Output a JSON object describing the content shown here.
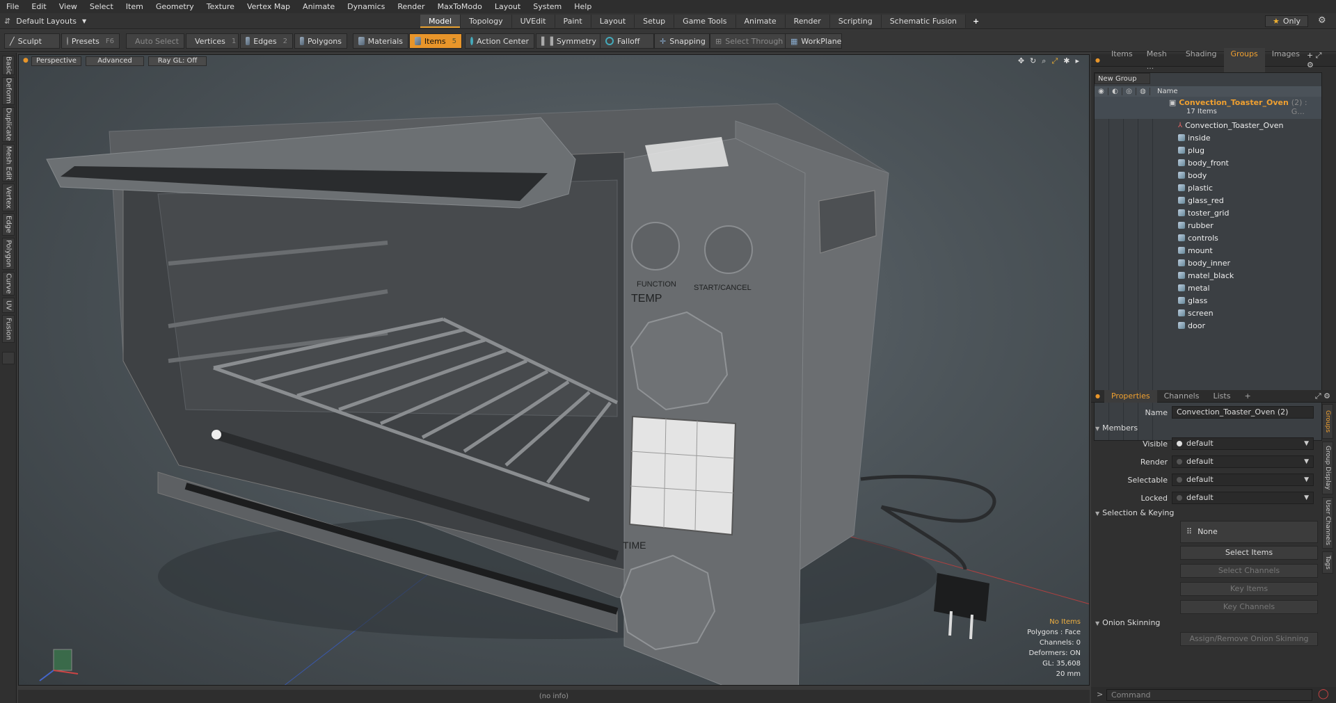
{
  "menu": [
    "File",
    "Edit",
    "View",
    "Select",
    "Item",
    "Geometry",
    "Texture",
    "Vertex Map",
    "Animate",
    "Dynamics",
    "Render",
    "MaxToModo",
    "Layout",
    "System",
    "Help"
  ],
  "layout_selector": "Default Layouts",
  "tabs": [
    "Model",
    "Topology",
    "UVEdit",
    "Paint",
    "Layout",
    "Setup",
    "Game Tools",
    "Animate",
    "Render",
    "Scripting",
    "Schematic Fusion"
  ],
  "only_label": "Only",
  "toolbar": {
    "sculpt": "Sculpt",
    "presets": "Presets",
    "presets_hotkey": "F6",
    "auto_select": "Auto Select",
    "vertices": "Vertices",
    "vertices_count": "1",
    "edges": "Edges",
    "edges_count": "2",
    "polygons": "Polygons",
    "materials": "Materials",
    "items": "Items",
    "items_count": "5",
    "action_center": "Action Center",
    "symmetry": "Symmetry",
    "falloff": "Falloff",
    "snapping": "Snapping",
    "select_through": "Select Through",
    "workplane": "WorkPlane"
  },
  "left_tabs": [
    "Basic",
    "Deform",
    "Duplicate",
    "Mesh Edit",
    "Vertex",
    "Edge",
    "Polygon",
    "Curve",
    "UV",
    "Fusion"
  ],
  "viewport": {
    "view": "Perspective",
    "mode": "Advanced",
    "raygl": "Ray GL: Off",
    "labels": {
      "function": "FUNCTION",
      "start_cancel": "START/CANCEL",
      "temp": "TEMP",
      "time": "TIME"
    },
    "info": {
      "no_items": "No Items",
      "polygons": "Polygons : Face",
      "channels": "Channels: 0",
      "deformers": "Deformers: ON",
      "gl": "GL: 35,608",
      "scale": "20 mm"
    }
  },
  "status": "(no info)",
  "right_tabs": [
    "Items",
    "Mesh ...",
    "Shading",
    "Groups",
    "Images"
  ],
  "groups": {
    "new_group": "New Group",
    "name_header": "Name",
    "group_name": "Convection_Toaster_Oven",
    "group_suffix": "(2) : G...",
    "group_count": "17 Items",
    "locator": "Convection_Toaster_Oven",
    "items": [
      "inside",
      "plug",
      "body_front",
      "body",
      "plastic",
      "glass_red",
      "toster_grid",
      "rubber",
      "controls",
      "mount",
      "body_inner",
      "matel_black",
      "metal",
      "glass",
      "screen",
      "door"
    ]
  },
  "prop_tabs": [
    "Properties",
    "Channels",
    "Lists"
  ],
  "properties": {
    "name_label": "Name",
    "name_value": "Convection_Toaster_Oven (2)",
    "members": "Members",
    "visible_label": "Visible",
    "render_label": "Render",
    "selectable_label": "Selectable",
    "locked_label": "Locked",
    "default": "default",
    "selection_keying": "Selection & Keying",
    "none": "None",
    "select_items": "Select Items",
    "select_channels": "Select Channels",
    "key_items": "Key Items",
    "key_channels": "Key Channels",
    "onion_skinning": "Onion Skinning",
    "assign_onion": "Assign/Remove Onion Skinning"
  },
  "prop_vtabs": [
    "Groups",
    "Group Display",
    "User Channels",
    "Tags"
  ],
  "command_placeholder": "Command",
  "colors": {
    "accent": "#e8952a",
    "group_name": "#f0a030"
  }
}
